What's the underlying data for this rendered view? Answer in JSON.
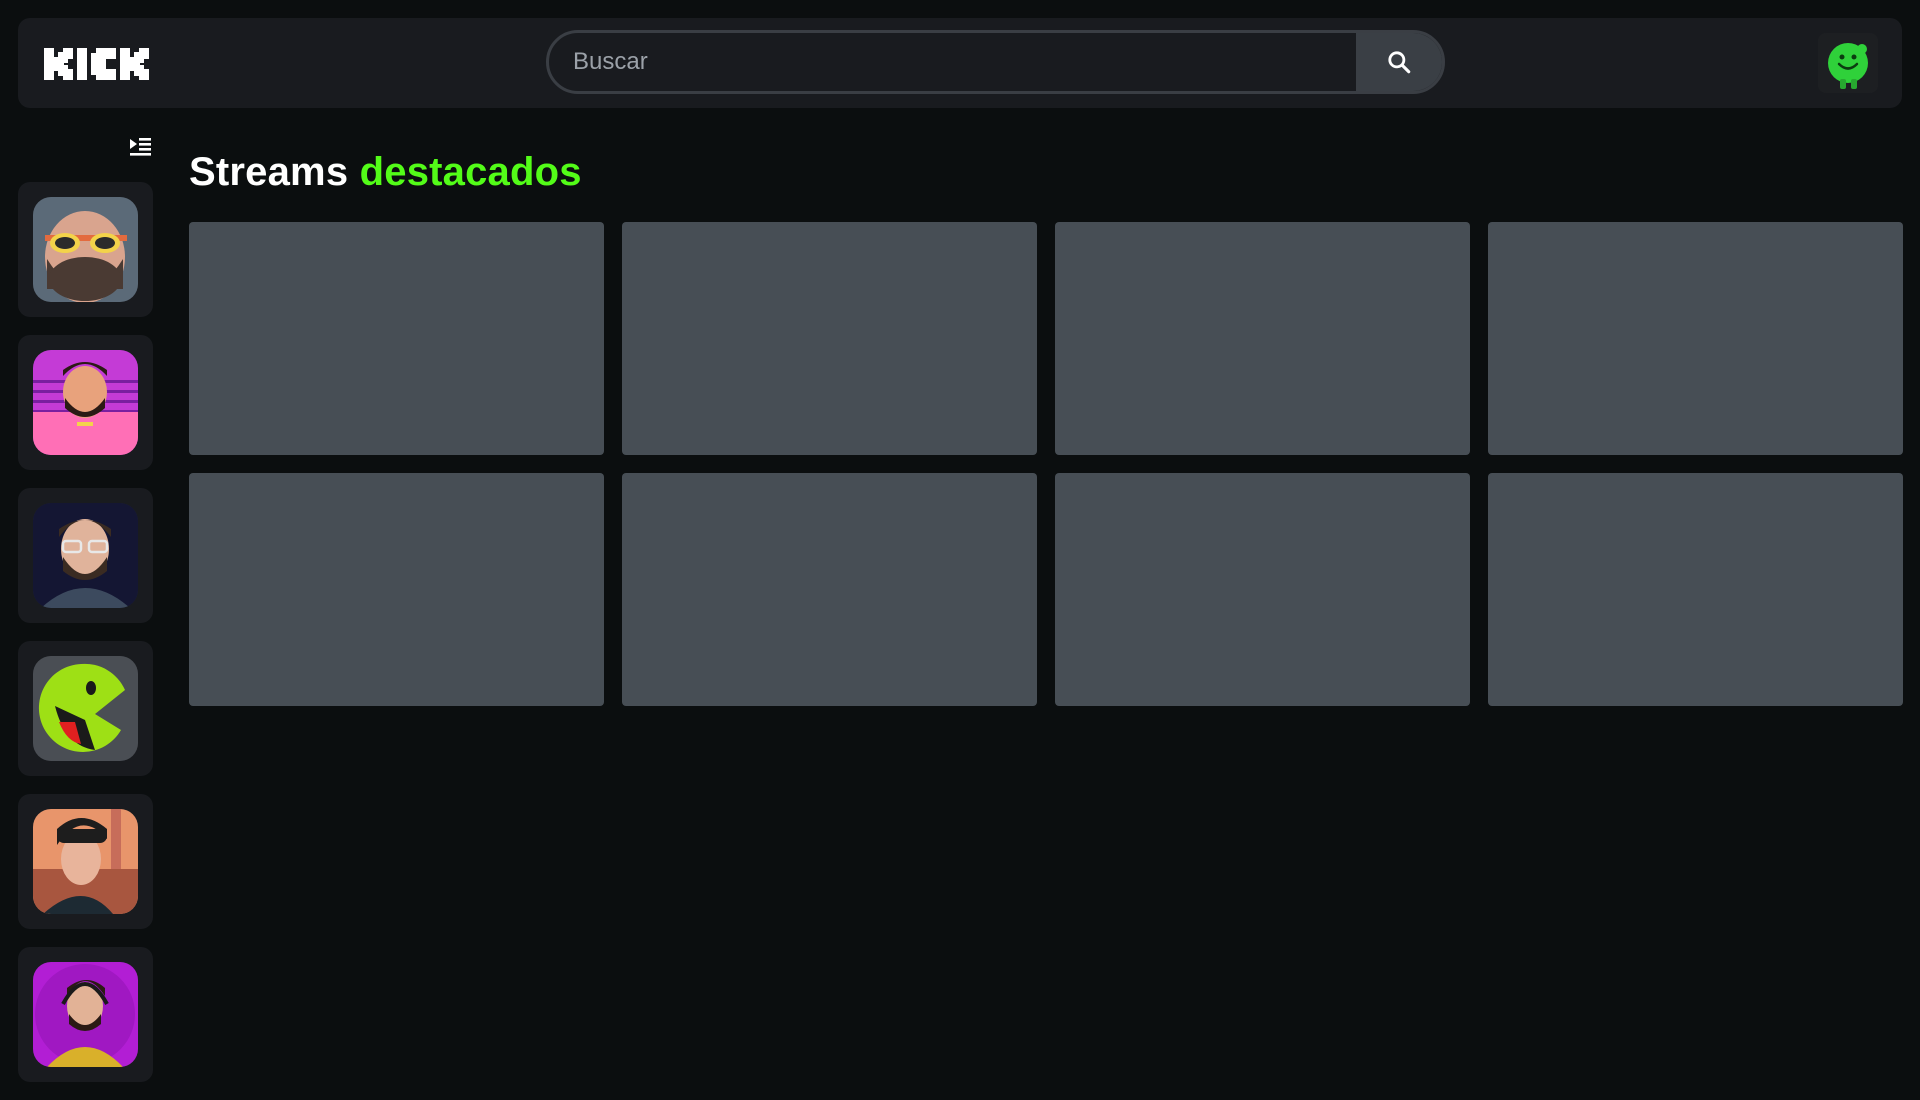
{
  "header": {
    "logo_text": "KICK",
    "search": {
      "placeholder": "Buscar",
      "value": ""
    },
    "search_icon": "search-icon",
    "user_avatar_icon": "green-character-avatar"
  },
  "sidebar": {
    "toggle_icon": "sidebar-expand-icon",
    "channels": [
      {
        "avatar": "bearded-man-yellow-sunglasses-avatar"
      },
      {
        "avatar": "man-pink-synthwave-avatar"
      },
      {
        "avatar": "bearded-man-glasses-dark-avatar"
      },
      {
        "avatar": "green-laughing-mascot-avatar"
      },
      {
        "avatar": "anime-man-city-avatar"
      },
      {
        "avatar": "man-headphones-purple-avatar"
      }
    ]
  },
  "main": {
    "title_prefix": "Streams",
    "title_accent": "destacados",
    "stream_cards": [
      {
        "state": "loading"
      },
      {
        "state": "loading"
      },
      {
        "state": "loading"
      },
      {
        "state": "loading"
      },
      {
        "state": "loading"
      },
      {
        "state": "loading"
      },
      {
        "state": "loading"
      },
      {
        "state": "loading"
      }
    ]
  },
  "colors": {
    "background": "#0b0e0f",
    "panel": "#191b1f",
    "accent": "#53fc18",
    "skeleton": "#474e55"
  }
}
